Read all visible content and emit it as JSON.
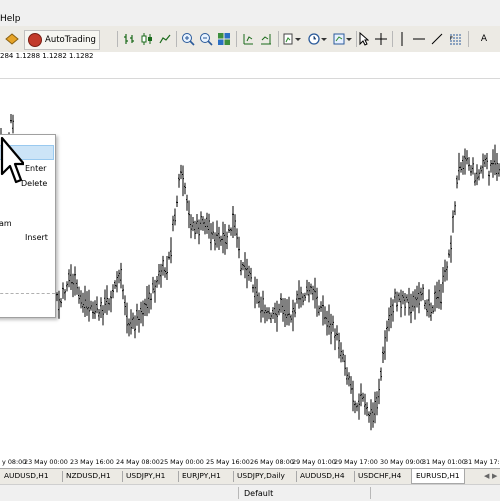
{
  "menu": {
    "help_label": "Help"
  },
  "toolbar": {
    "autotrading_label": "AutoTrading",
    "tools": [
      {
        "name": "new-order-icon"
      },
      {
        "name": "autotrading-icon"
      },
      {
        "name": "bar-chart-icon"
      },
      {
        "name": "candlestick-icon"
      },
      {
        "name": "line-chart-icon"
      },
      {
        "name": "zoom-in-icon"
      },
      {
        "name": "zoom-out-icon"
      },
      {
        "name": "tile-windows-icon"
      },
      {
        "name": "chart-shift-icon"
      },
      {
        "name": "autoscroll-icon"
      },
      {
        "name": "indicators-icon"
      },
      {
        "name": "periods-icon"
      },
      {
        "name": "templates-icon"
      },
      {
        "name": "cursor-icon"
      },
      {
        "name": "crosshair-icon"
      },
      {
        "name": "vertical-line-icon"
      },
      {
        "name": "horizontal-line-icon"
      },
      {
        "name": "trendline-icon"
      },
      {
        "name": "fibonacci-icon"
      },
      {
        "name": "text-tool-icon"
      }
    ],
    "text_tool_label": "A"
  },
  "quote_line": "284 1.1288 1.1282 1.1282",
  "context_menu": {
    "items": [
      {
        "label": "Enter"
      },
      {
        "label": "Delete"
      },
      {
        "label": "am"
      },
      {
        "label": "Insert"
      }
    ]
  },
  "time_axis": [
    "y 08:00",
    "23 May 00:00",
    "23 May 16:00",
    "24 May 08:00",
    "25 May 00:00",
    "25 May 16:00",
    "26 May 08:00",
    "29 May 01:00",
    "29 May 17:00",
    "30 May 09:00",
    "31 May 01:00",
    "31 May 17:00"
  ],
  "tabs": [
    "AUDUSD,H1",
    "NZDUSD,H1",
    "USDJPY,H1",
    "EURJPY,H1",
    "USDJPY,Daily",
    "AUDUSD,H4",
    "USDCHF,H4",
    "EURUSD,H1"
  ],
  "active_tab": "EURUSD,H1",
  "status": {
    "profile": "Default"
  },
  "chart_data": {
    "type": "candlestick-ohlc-bars",
    "symbol_tab": "EURUSD,H1",
    "x_tick_labels": [
      "y 08:00",
      "23 May 00:00",
      "23 May 16:00",
      "24 May 08:00",
      "25 May 00:00",
      "25 May 16:00",
      "26 May 08:00",
      "29 May 01:00",
      "29 May 17:00",
      "30 May 09:00",
      "31 May 01:00",
      "31 May 17:00"
    ],
    "price_path_relative": [
      [
        0,
        0.15
      ],
      [
        6,
        0.2
      ],
      [
        12,
        0.1
      ],
      [
        18,
        0.3
      ],
      [
        22,
        0.25
      ],
      [
        30,
        0.55
      ],
      [
        40,
        0.58
      ],
      [
        50,
        0.56
      ],
      [
        60,
        0.6
      ],
      [
        70,
        0.52
      ],
      [
        80,
        0.58
      ],
      [
        90,
        0.6
      ],
      [
        100,
        0.62
      ],
      [
        110,
        0.58
      ],
      [
        120,
        0.52
      ],
      [
        130,
        0.66
      ],
      [
        140,
        0.62
      ],
      [
        150,
        0.58
      ],
      [
        160,
        0.52
      ],
      [
        168,
        0.5
      ],
      [
        178,
        0.3
      ],
      [
        182,
        0.25
      ],
      [
        188,
        0.36
      ],
      [
        196,
        0.4
      ],
      [
        206,
        0.38
      ],
      [
        216,
        0.42
      ],
      [
        224,
        0.44
      ],
      [
        234,
        0.38
      ],
      [
        240,
        0.48
      ],
      [
        248,
        0.5
      ],
      [
        256,
        0.56
      ],
      [
        264,
        0.62
      ],
      [
        272,
        0.64
      ],
      [
        280,
        0.6
      ],
      [
        290,
        0.62
      ],
      [
        300,
        0.58
      ],
      [
        310,
        0.56
      ],
      [
        316,
        0.58
      ],
      [
        324,
        0.62
      ],
      [
        332,
        0.66
      ],
      [
        340,
        0.7
      ],
      [
        346,
        0.76
      ],
      [
        352,
        0.82
      ],
      [
        356,
        0.86
      ],
      [
        362,
        0.84
      ],
      [
        366,
        0.88
      ],
      [
        372,
        0.9
      ],
      [
        378,
        0.84
      ],
      [
        384,
        0.72
      ],
      [
        390,
        0.62
      ],
      [
        396,
        0.58
      ],
      [
        404,
        0.58
      ],
      [
        414,
        0.6
      ],
      [
        424,
        0.58
      ],
      [
        432,
        0.6
      ],
      [
        438,
        0.58
      ],
      [
        442,
        0.56
      ],
      [
        448,
        0.48
      ],
      [
        452,
        0.42
      ],
      [
        456,
        0.3
      ],
      [
        460,
        0.22
      ],
      [
        466,
        0.2
      ],
      [
        472,
        0.24
      ],
      [
        478,
        0.26
      ],
      [
        484,
        0.22
      ],
      [
        490,
        0.25
      ],
      [
        496,
        0.22
      ],
      [
        500,
        0.24
      ]
    ]
  }
}
